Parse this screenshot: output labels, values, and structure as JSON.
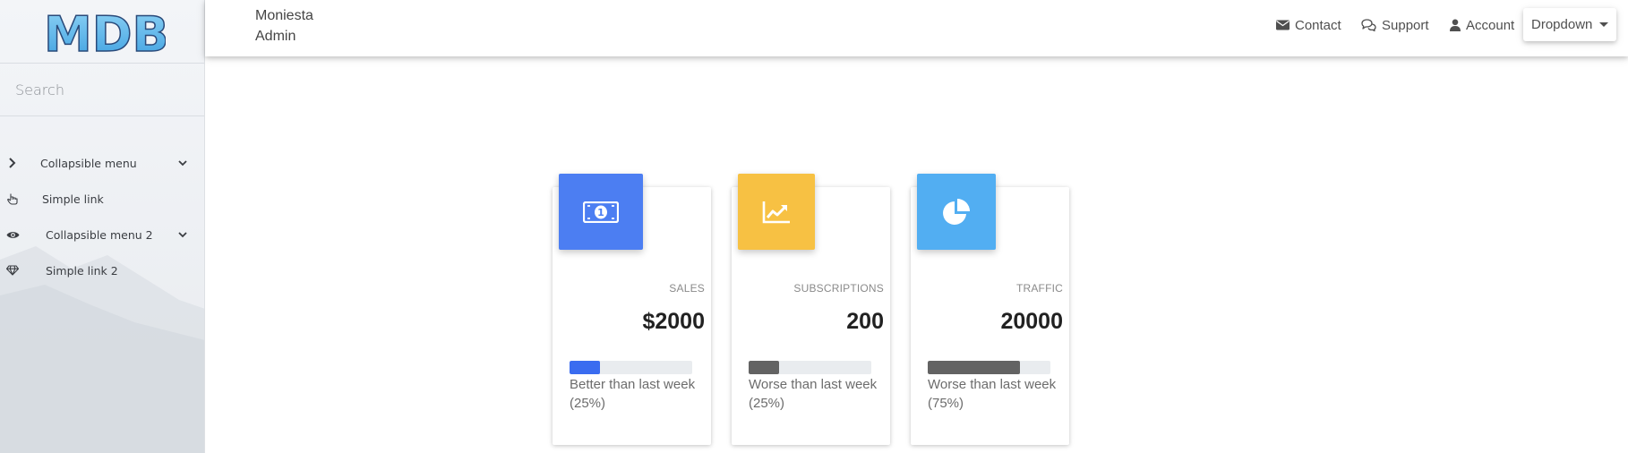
{
  "sidebar": {
    "logo_text": "MDB",
    "search_placeholder": "Search",
    "items": [
      {
        "label": "Collapsible menu",
        "icon": "chevron-right-icon",
        "has_submenu": true
      },
      {
        "label": "Simple link",
        "icon": "hand-pointer-icon",
        "has_submenu": false
      },
      {
        "label": "Collapsible menu 2",
        "icon": "eye-icon",
        "has_submenu": true
      },
      {
        "label": "Simple link 2",
        "icon": "gem-icon",
        "has_submenu": false
      }
    ]
  },
  "navbar": {
    "brand_line1": "Moniesta",
    "brand_line2": "Admin",
    "links": [
      {
        "label": "Contact",
        "icon": "envelope-icon"
      },
      {
        "label": "Support",
        "icon": "comments-icon"
      },
      {
        "label": "Account",
        "icon": "user-icon"
      }
    ],
    "dropdown_label": "Dropdown"
  },
  "cards": [
    {
      "title": "SALES",
      "value": "$2000",
      "note": "Better than last week (25%)",
      "progress": 0.25,
      "icon": "money-bill-icon",
      "icon_color": "#4c7ef2",
      "bar_color": "#3a6cf0"
    },
    {
      "title": "SUBSCRIPTIONS",
      "value": "200",
      "note": "Worse than last week (25%)",
      "progress": 0.25,
      "icon": "chart-line-icon",
      "icon_color": "#f7c143",
      "bar_color": "#636363"
    },
    {
      "title": "TRAFFIC",
      "value": "20000",
      "note": "Worse than last week (75%)",
      "progress": 0.75,
      "icon": "chart-pie-icon",
      "icon_color": "#52aef2",
      "bar_color": "#636363"
    }
  ]
}
